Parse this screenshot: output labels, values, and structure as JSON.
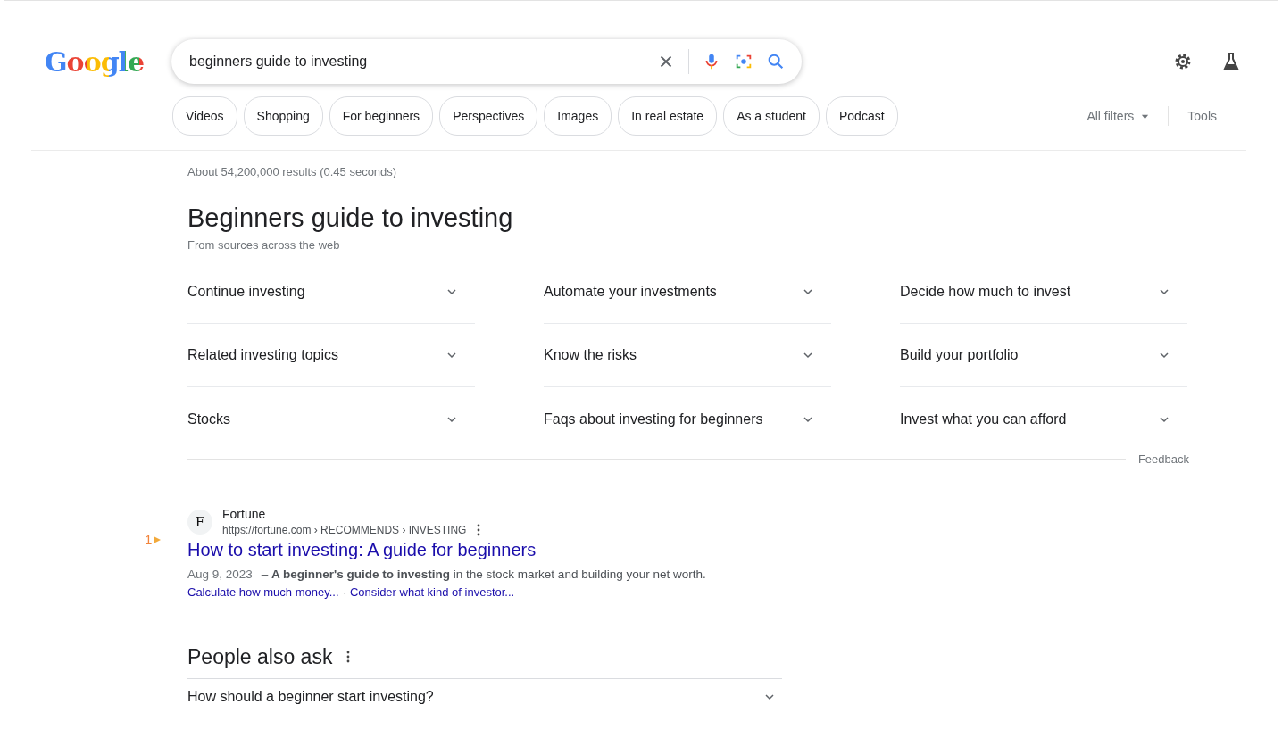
{
  "logo": "Google",
  "search": {
    "value": "beginners guide to investing"
  },
  "chips": [
    "Videos",
    "Shopping",
    "For beginners",
    "Perspectives",
    "Images",
    "In real estate",
    "As a student",
    "Podcast"
  ],
  "filters": {
    "all_filters": "All filters",
    "tools": "Tools"
  },
  "result_stats": "About 54,200,000 results (0.45 seconds)",
  "guide": {
    "title": "Beginners guide to investing",
    "subtitle": "From sources across the web",
    "topics": [
      {
        "label": "Continue investing",
        "expanded": false
      },
      {
        "label": "Automate your investments",
        "expanded": false
      },
      {
        "label": "Decide how much to invest",
        "expanded": false
      },
      {
        "label": "Related investing topics",
        "expanded": false
      },
      {
        "label": "Know the risks",
        "expanded": false
      },
      {
        "label": "Build your portfolio",
        "expanded": false
      },
      {
        "label": "Stocks",
        "expanded": false
      },
      {
        "label": "Faqs about investing for beginners",
        "expanded": false
      },
      {
        "label": "Invest what you can afford",
        "expanded": false
      }
    ],
    "feedback": "Feedback"
  },
  "results": [
    {
      "marker": "1",
      "favicon": "F",
      "site": "Fortune",
      "url": "https://fortune.com › RECOMMENDS › INVESTING",
      "title": "How to start investing: A guide for beginners",
      "date": "Aug 9, 2023",
      "snippet": "– **A beginner's guide to investing** in the stock market and building your net worth.",
      "sitelink_separator": "·",
      "sitelinks": [
        "Calculate how much money...",
        "Consider what kind of investor..."
      ]
    }
  ],
  "people_also_ask": {
    "title": "People also ask",
    "questions": [
      {
        "text": "How should a beginner start investing?",
        "expanded": false
      }
    ]
  }
}
